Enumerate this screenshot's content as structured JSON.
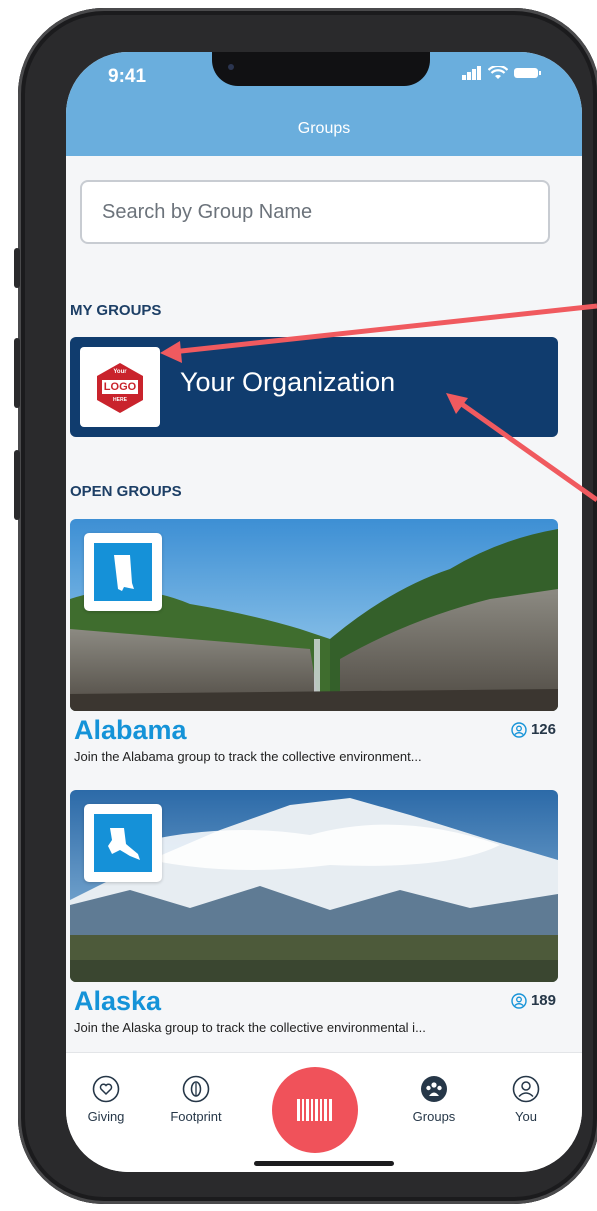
{
  "status_bar": {
    "time": "9:41"
  },
  "header": {
    "title": "Groups"
  },
  "search": {
    "placeholder": "Search by Group Name"
  },
  "my_groups": {
    "section_title": "MY GROUPS",
    "logo_text": {
      "top": "Your",
      "main": "LOGO",
      "bottom": "HERE"
    },
    "name": "Your Organization"
  },
  "open_groups": {
    "section_title": "OPEN GROUPS",
    "items": [
      {
        "name": "Alabama",
        "members": "126",
        "description": "Join the Alabama group to track the collective environment..."
      },
      {
        "name": "Alaska",
        "members": "189",
        "description": "Join the Alaska group to track the collective environmental i..."
      }
    ]
  },
  "tabbar": {
    "items": [
      {
        "label": "Giving",
        "icon": "heart-icon"
      },
      {
        "label": "Footprint",
        "icon": "leaf-icon"
      },
      {
        "label": "",
        "icon": "barcode-icon"
      },
      {
        "label": "Groups",
        "icon": "groups-icon"
      },
      {
        "label": "You",
        "icon": "user-icon"
      }
    ]
  },
  "colors": {
    "header": "#6aaedd",
    "navy": "#103c6e",
    "accent_blue": "#1593d8",
    "scan_red": "#f0525a",
    "annotation_arrow": "#f05a5f"
  }
}
